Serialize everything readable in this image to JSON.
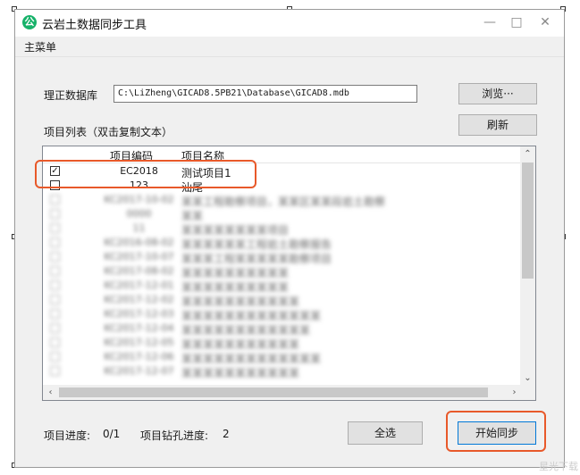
{
  "window": {
    "title": "云岩土数据同步工具",
    "icon_glyph": "公"
  },
  "menu": {
    "items": [
      "主菜单"
    ]
  },
  "db": {
    "label": "理正数据库",
    "path": "C:\\LiZheng\\GICAD8.5PB21\\Database\\GICAD8.mdb",
    "browse_label": "浏览···",
    "refresh_label": "刷新"
  },
  "list": {
    "label": "项目列表（双击复制文本）",
    "columns": [
      "项目编码",
      "项目名称"
    ],
    "rows": [
      {
        "checked": true,
        "code": "EC2018",
        "name": "测试项目1"
      },
      {
        "checked": false,
        "code": "123",
        "name": "汕尾"
      }
    ],
    "blurred_rows": [
      {
        "code": "KC2017-10-02",
        "name": "某某工程勘察项目，某某区某某段岩土勘察"
      },
      {
        "code": "0000",
        "name": "某某"
      },
      {
        "code": "11",
        "name": "某某某某某某某某项目"
      },
      {
        "code": "KC2016-08-02",
        "name": "某某某某某某工程岩土勘察报告"
      },
      {
        "code": "KC2017-10-07",
        "name": "某某某工程某某某某某勘察项目"
      },
      {
        "code": "KC2017-08-02",
        "name": "某某某某某某某某某某"
      },
      {
        "code": "KC2017-12-01",
        "name": "某某某某某某某某某某"
      },
      {
        "code": "KC2017-12-02",
        "name": "某某某某某某某某某某某"
      },
      {
        "code": "KC2017-12-03",
        "name": "某某某某某某某某某某某某某"
      },
      {
        "code": "KC2017-12-04",
        "name": "某某某某某某某某某某某某"
      },
      {
        "code": "KC2017-12-05",
        "name": "某某某某某某某某某某某"
      },
      {
        "code": "KC2017-12-06",
        "name": "某某某某某某某某某某某某某"
      },
      {
        "code": "KC2017-12-07",
        "name": "某某某某某某某某某某某"
      }
    ]
  },
  "footer": {
    "progress_label": "项目进度:",
    "progress_value": "0/1",
    "drill_label": "项目钻孔进度:",
    "drill_value": "2",
    "select_all_label": "全选",
    "start_sync_label": "开始同步"
  },
  "colors": {
    "highlight": "#e8592a",
    "app_icon": "#17b26a"
  },
  "watermark": "星光下载"
}
